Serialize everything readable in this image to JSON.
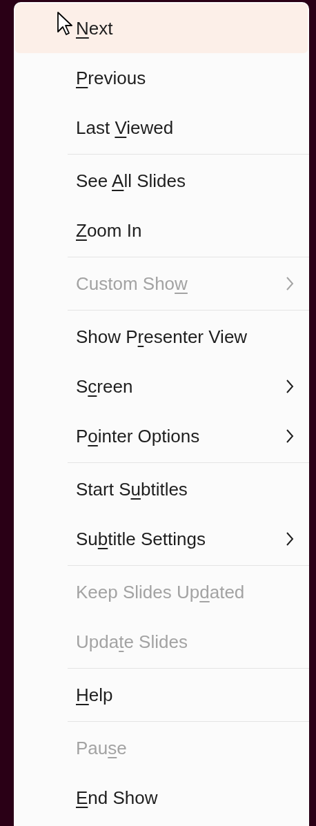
{
  "menu": {
    "groups": [
      {
        "items": [
          {
            "key": "N",
            "after": "ext",
            "selected": true,
            "disabled": false,
            "submenu": false
          },
          {
            "key": "P",
            "after": "revious",
            "selected": false,
            "disabled": false,
            "submenu": false
          },
          {
            "before": "Last ",
            "key": "V",
            "after": "iewed",
            "selected": false,
            "disabled": false,
            "submenu": false
          }
        ]
      },
      {
        "items": [
          {
            "before": "See ",
            "key": "A",
            "after": "ll Slides",
            "selected": false,
            "disabled": false,
            "submenu": false
          },
          {
            "key": "Z",
            "after": "oom In",
            "selected": false,
            "disabled": false,
            "submenu": false
          }
        ]
      },
      {
        "items": [
          {
            "before": "Custom Sho",
            "key": "w",
            "selected": false,
            "disabled": true,
            "submenu": true
          }
        ]
      },
      {
        "items": [
          {
            "before": "Show P",
            "key": "r",
            "after": "esenter View",
            "selected": false,
            "disabled": false,
            "submenu": false
          },
          {
            "before": "S",
            "key": "c",
            "after": "reen",
            "selected": false,
            "disabled": false,
            "submenu": true
          },
          {
            "before": "P",
            "key": "o",
            "after": "inter Options",
            "selected": false,
            "disabled": false,
            "submenu": true
          }
        ]
      },
      {
        "items": [
          {
            "before": "Start S",
            "key": "u",
            "after": "btitles",
            "selected": false,
            "disabled": false,
            "submenu": false
          },
          {
            "before": "Su",
            "key": "b",
            "after": "title Settings",
            "selected": false,
            "disabled": false,
            "submenu": true
          }
        ]
      },
      {
        "items": [
          {
            "before": "Keep Slides Up",
            "key": "d",
            "after": "ated",
            "selected": false,
            "disabled": true,
            "submenu": false
          },
          {
            "before": "Upda",
            "key": "t",
            "after": "e Slides",
            "selected": false,
            "disabled": true,
            "submenu": false
          }
        ]
      },
      {
        "items": [
          {
            "key": "H",
            "after": "elp",
            "selected": false,
            "disabled": false,
            "submenu": false
          }
        ]
      },
      {
        "items": [
          {
            "before": "Pau",
            "key": "s",
            "after": "e",
            "selected": false,
            "disabled": true,
            "submenu": false
          },
          {
            "key": "E",
            "after": "nd Show",
            "selected": false,
            "disabled": false,
            "submenu": false
          }
        ]
      }
    ]
  }
}
